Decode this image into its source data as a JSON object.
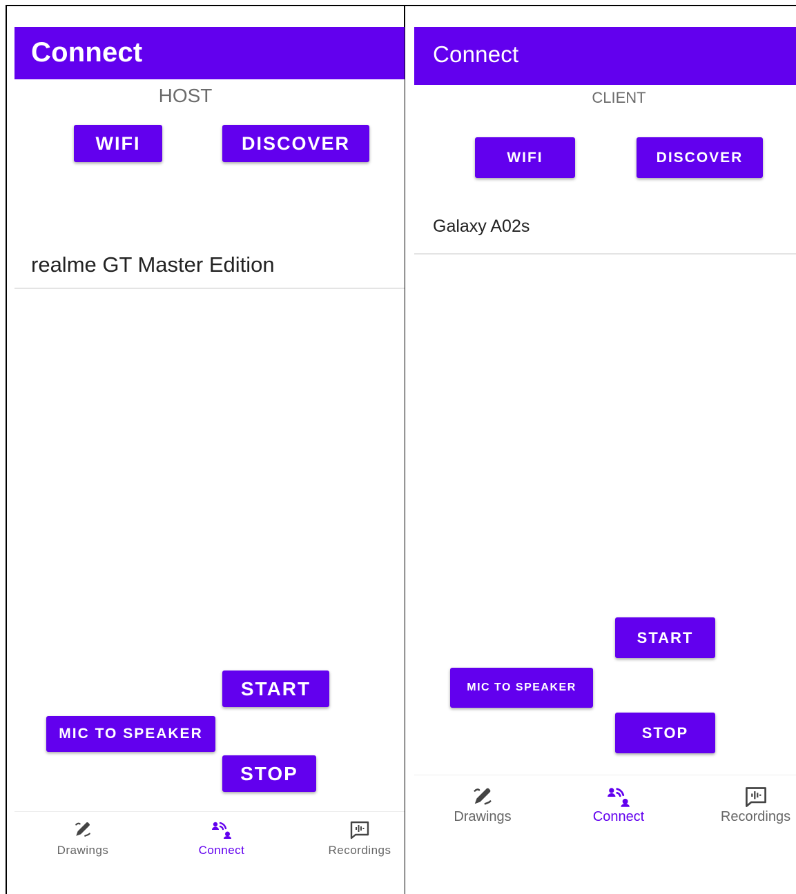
{
  "host": {
    "appbar": {
      "title": "Connect"
    },
    "role": "HOST",
    "buttons": {
      "wifi": "WIFI",
      "discover": "DISCOVER",
      "start": "START",
      "mic_to_speaker": "MIC TO SPEAKER",
      "stop": "STOP"
    },
    "devices": [
      "realme GT Master Edition"
    ],
    "nav": [
      {
        "label": "Drawings",
        "icon": "draw-icon",
        "active": false
      },
      {
        "label": "Connect",
        "icon": "connect-icon",
        "active": true
      },
      {
        "label": "Recordings",
        "icon": "recordings-icon",
        "active": false
      }
    ]
  },
  "client": {
    "appbar": {
      "title": "Connect"
    },
    "role": "CLIENT",
    "buttons": {
      "wifi": "WIFI",
      "discover": "DISCOVER",
      "start": "START",
      "mic_to_speaker": "MIC TO SPEAKER",
      "stop": "STOP"
    },
    "devices": [
      "Galaxy A02s"
    ],
    "nav": [
      {
        "label": "Drawings",
        "icon": "draw-icon",
        "active": false
      },
      {
        "label": "Connect",
        "icon": "connect-icon",
        "active": true
      },
      {
        "label": "Recordings",
        "icon": "recordings-icon",
        "active": false
      }
    ]
  },
  "colors": {
    "primary": "#6200ee",
    "text_secondary": "#666666",
    "divider": "#e4e4e4"
  }
}
